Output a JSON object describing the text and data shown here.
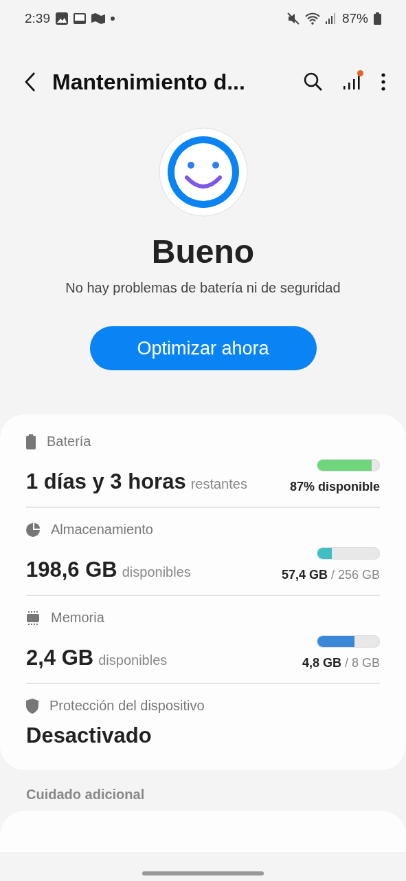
{
  "status_bar": {
    "time": "2:39",
    "battery": "87%"
  },
  "header": {
    "title": "Mantenimiento d...",
    "notification_dot": true
  },
  "status": {
    "title": "Bueno",
    "subtitle": "No hay problemas de batería ni de seguridad"
  },
  "action_button": "Optimizar ahora",
  "items": [
    {
      "kind": "battery",
      "label": "Batería",
      "value": "1 días y 3 horas",
      "suffix": "restantes",
      "level": 0.88,
      "color": "#6fd67c",
      "detail_strong": "87% disponible"
    },
    {
      "kind": "storage",
      "label": "Almacenamiento",
      "value": "198,6 GB",
      "suffix": "disponibles",
      "level": 0.23,
      "color": "#3fbfc4",
      "detail_strong": "57,4 GB",
      "detail_rest": "/ 256 GB"
    },
    {
      "kind": "memory",
      "label": "Memoria",
      "value": "2,4 GB",
      "suffix": "disponibles",
      "level": 0.6,
      "color": "#3b87d8",
      "detail_strong": "4,8 GB",
      "detail_rest": "/ 8 GB"
    },
    {
      "kind": "protection",
      "label": "Protección del dispositivo",
      "value": "Desactivado"
    }
  ],
  "section_title": "Cuidado adicional"
}
